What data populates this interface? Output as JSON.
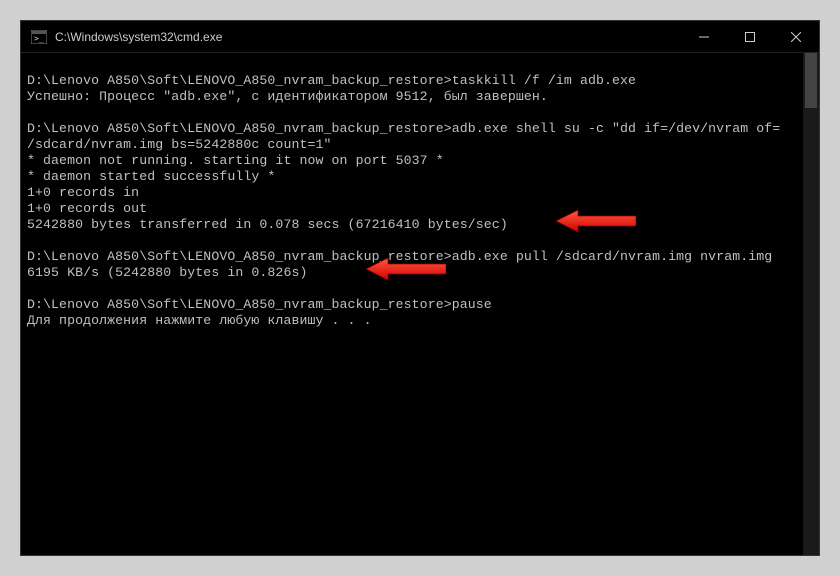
{
  "window": {
    "title": "C:\\Windows\\system32\\cmd.exe"
  },
  "terminal": {
    "lines": [
      "",
      "D:\\Lenovo A850\\Soft\\LENOVO_A850_nvram_backup_restore>taskkill /f /im adb.exe",
      "Успешно: Процесс \"adb.exe\", с идентификатором 9512, был завершен.",
      "",
      "D:\\Lenovo A850\\Soft\\LENOVO_A850_nvram_backup_restore>adb.exe shell su -c \"dd if=/dev/nvram of=",
      "/sdcard/nvram.img bs=5242880c count=1\"",
      "* daemon not running. starting it now on port 5037 *",
      "* daemon started successfully *",
      "1+0 records in",
      "1+0 records out",
      "5242880 bytes transferred in 0.078 secs (67216410 bytes/sec)",
      "",
      "D:\\Lenovo A850\\Soft\\LENOVO_A850_nvram_backup_restore>adb.exe pull /sdcard/nvram.img nvram.img",
      "6195 KB/s (5242880 bytes in 0.826s)",
      "",
      "D:\\Lenovo A850\\Soft\\LENOVO_A850_nvram_backup_restore>pause",
      "Для продолжения нажмите любую клавишу . . ."
    ]
  }
}
